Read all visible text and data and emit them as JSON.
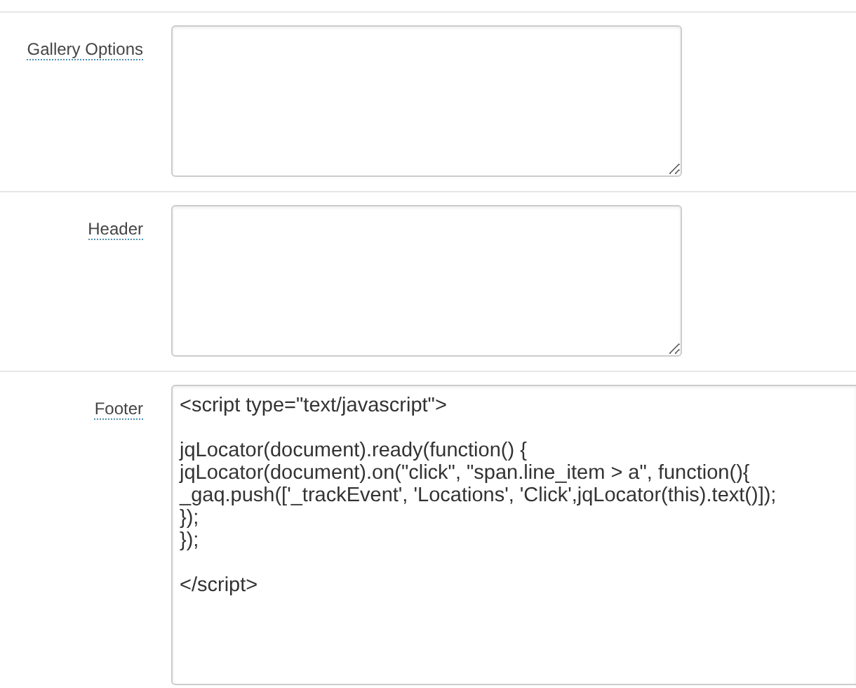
{
  "fields": [
    {
      "label": "Gallery Options",
      "kind": "box"
    },
    {
      "label": "Header",
      "kind": "box"
    },
    {
      "label": "Footer",
      "kind": "code",
      "value": "<script type=\"text/javascript\">\n\njqLocator(document).ready(function() {\njqLocator(document).on(\"click\", \"span.line_item > a\", function(){\n_gaq.push(['_trackEvent', 'Locations', 'Click',jqLocator(this).text()]);\n});\n});\n\n</script>"
    }
  ]
}
